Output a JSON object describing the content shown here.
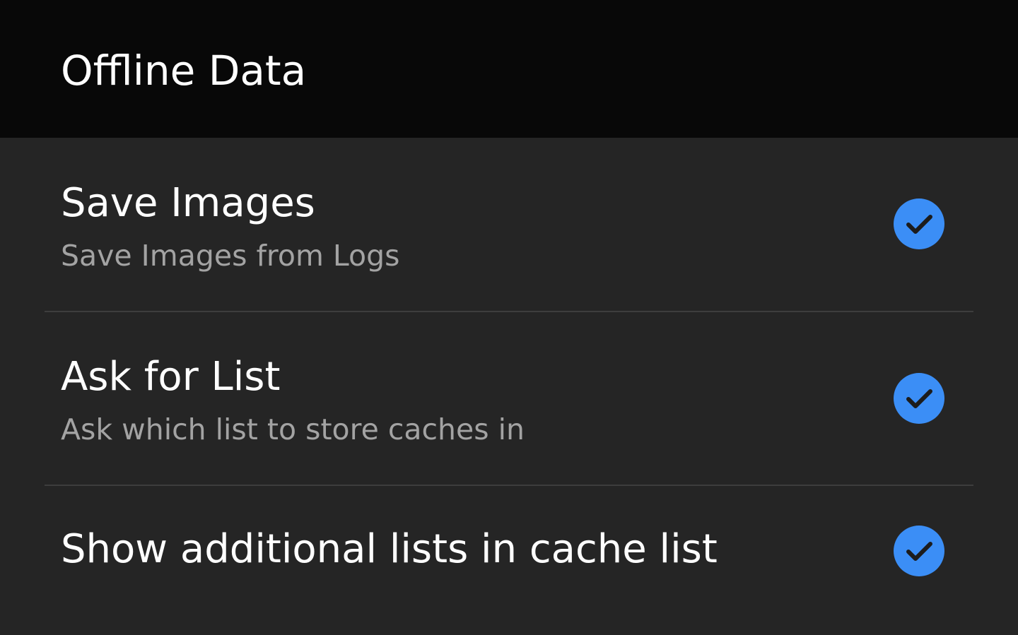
{
  "header": {
    "title": "Offline Data"
  },
  "preferences": [
    {
      "title": "Save Images",
      "summary": "Save Images from Logs",
      "checked": true,
      "check_icon": "check-icon"
    },
    {
      "title": "Ask for List",
      "summary": "Ask which list to store caches in",
      "checked": true,
      "check_icon": "check-icon"
    },
    {
      "title": "Show additional lists in cache list",
      "summary": "",
      "checked": true,
      "check_icon": "check-icon"
    }
  ],
  "colors": {
    "header_bg": "#080808",
    "body_bg": "#252525",
    "accent": "#3b8ef6",
    "summary_text": "#a3a3a3",
    "divider": "#3d3d3d"
  }
}
